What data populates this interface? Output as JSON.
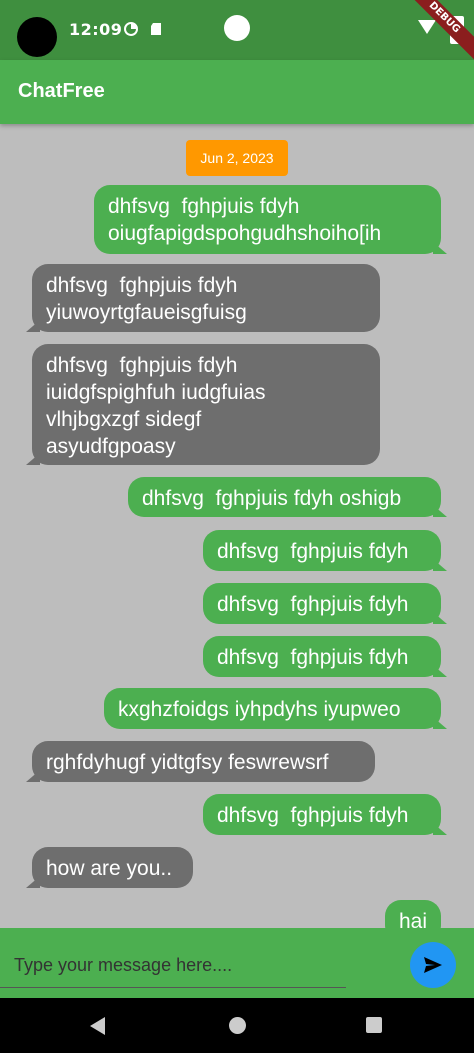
{
  "status_bar": {
    "time": "12:09",
    "debug_label": "DEBUG"
  },
  "app_bar": {
    "title": "ChatFree"
  },
  "chat": {
    "date": "Jun 2, 2023",
    "messages": [
      {
        "text": "dhfsvg  fghpjuis fdyh\noiugfapigdspohgudhshoiho[ih",
        "direction": "outgoing"
      },
      {
        "text": "dhfsvg  fghpjuis fdyh\nyiuwoyrtgfaueisgfuisg",
        "direction": "incoming"
      },
      {
        "text": "dhfsvg  fghpjuis fdyh\niuidgfspighfuh iudgfuias\nvlhjbgxzgf sidegf\nasyudfgpoasy",
        "direction": "incoming"
      },
      {
        "text": "dhfsvg  fghpjuis fdyh oshigb",
        "direction": "outgoing"
      },
      {
        "text": "dhfsvg  fghpjuis fdyh",
        "direction": "outgoing"
      },
      {
        "text": "dhfsvg  fghpjuis fdyh",
        "direction": "outgoing"
      },
      {
        "text": "dhfsvg  fghpjuis fdyh",
        "direction": "outgoing"
      },
      {
        "text": "kxghzfoidgs iyhpdyhs iyupweo",
        "direction": "outgoing"
      },
      {
        "text": "rghfdyhugf yidtgfsy feswrewsrf",
        "direction": "incoming"
      },
      {
        "text": "dhfsvg  fghpjuis fdyh",
        "direction": "outgoing"
      },
      {
        "text": "how are you..",
        "direction": "incoming"
      },
      {
        "text": "hai",
        "direction": "outgoing"
      }
    ]
  },
  "composer": {
    "placeholder": "Type your message here...."
  },
  "icons": {
    "send": "send-icon",
    "back": "back-icon",
    "home": "home-icon",
    "recents": "recents-icon"
  },
  "colors": {
    "app_bar": "#4caf50",
    "status_bar": "#3f8f3f",
    "outgoing": "#4caf50",
    "incoming": "#6e6e6e",
    "date_chip": "#ff9800",
    "send_button": "#2196f3",
    "background": "#bdbdbd"
  }
}
